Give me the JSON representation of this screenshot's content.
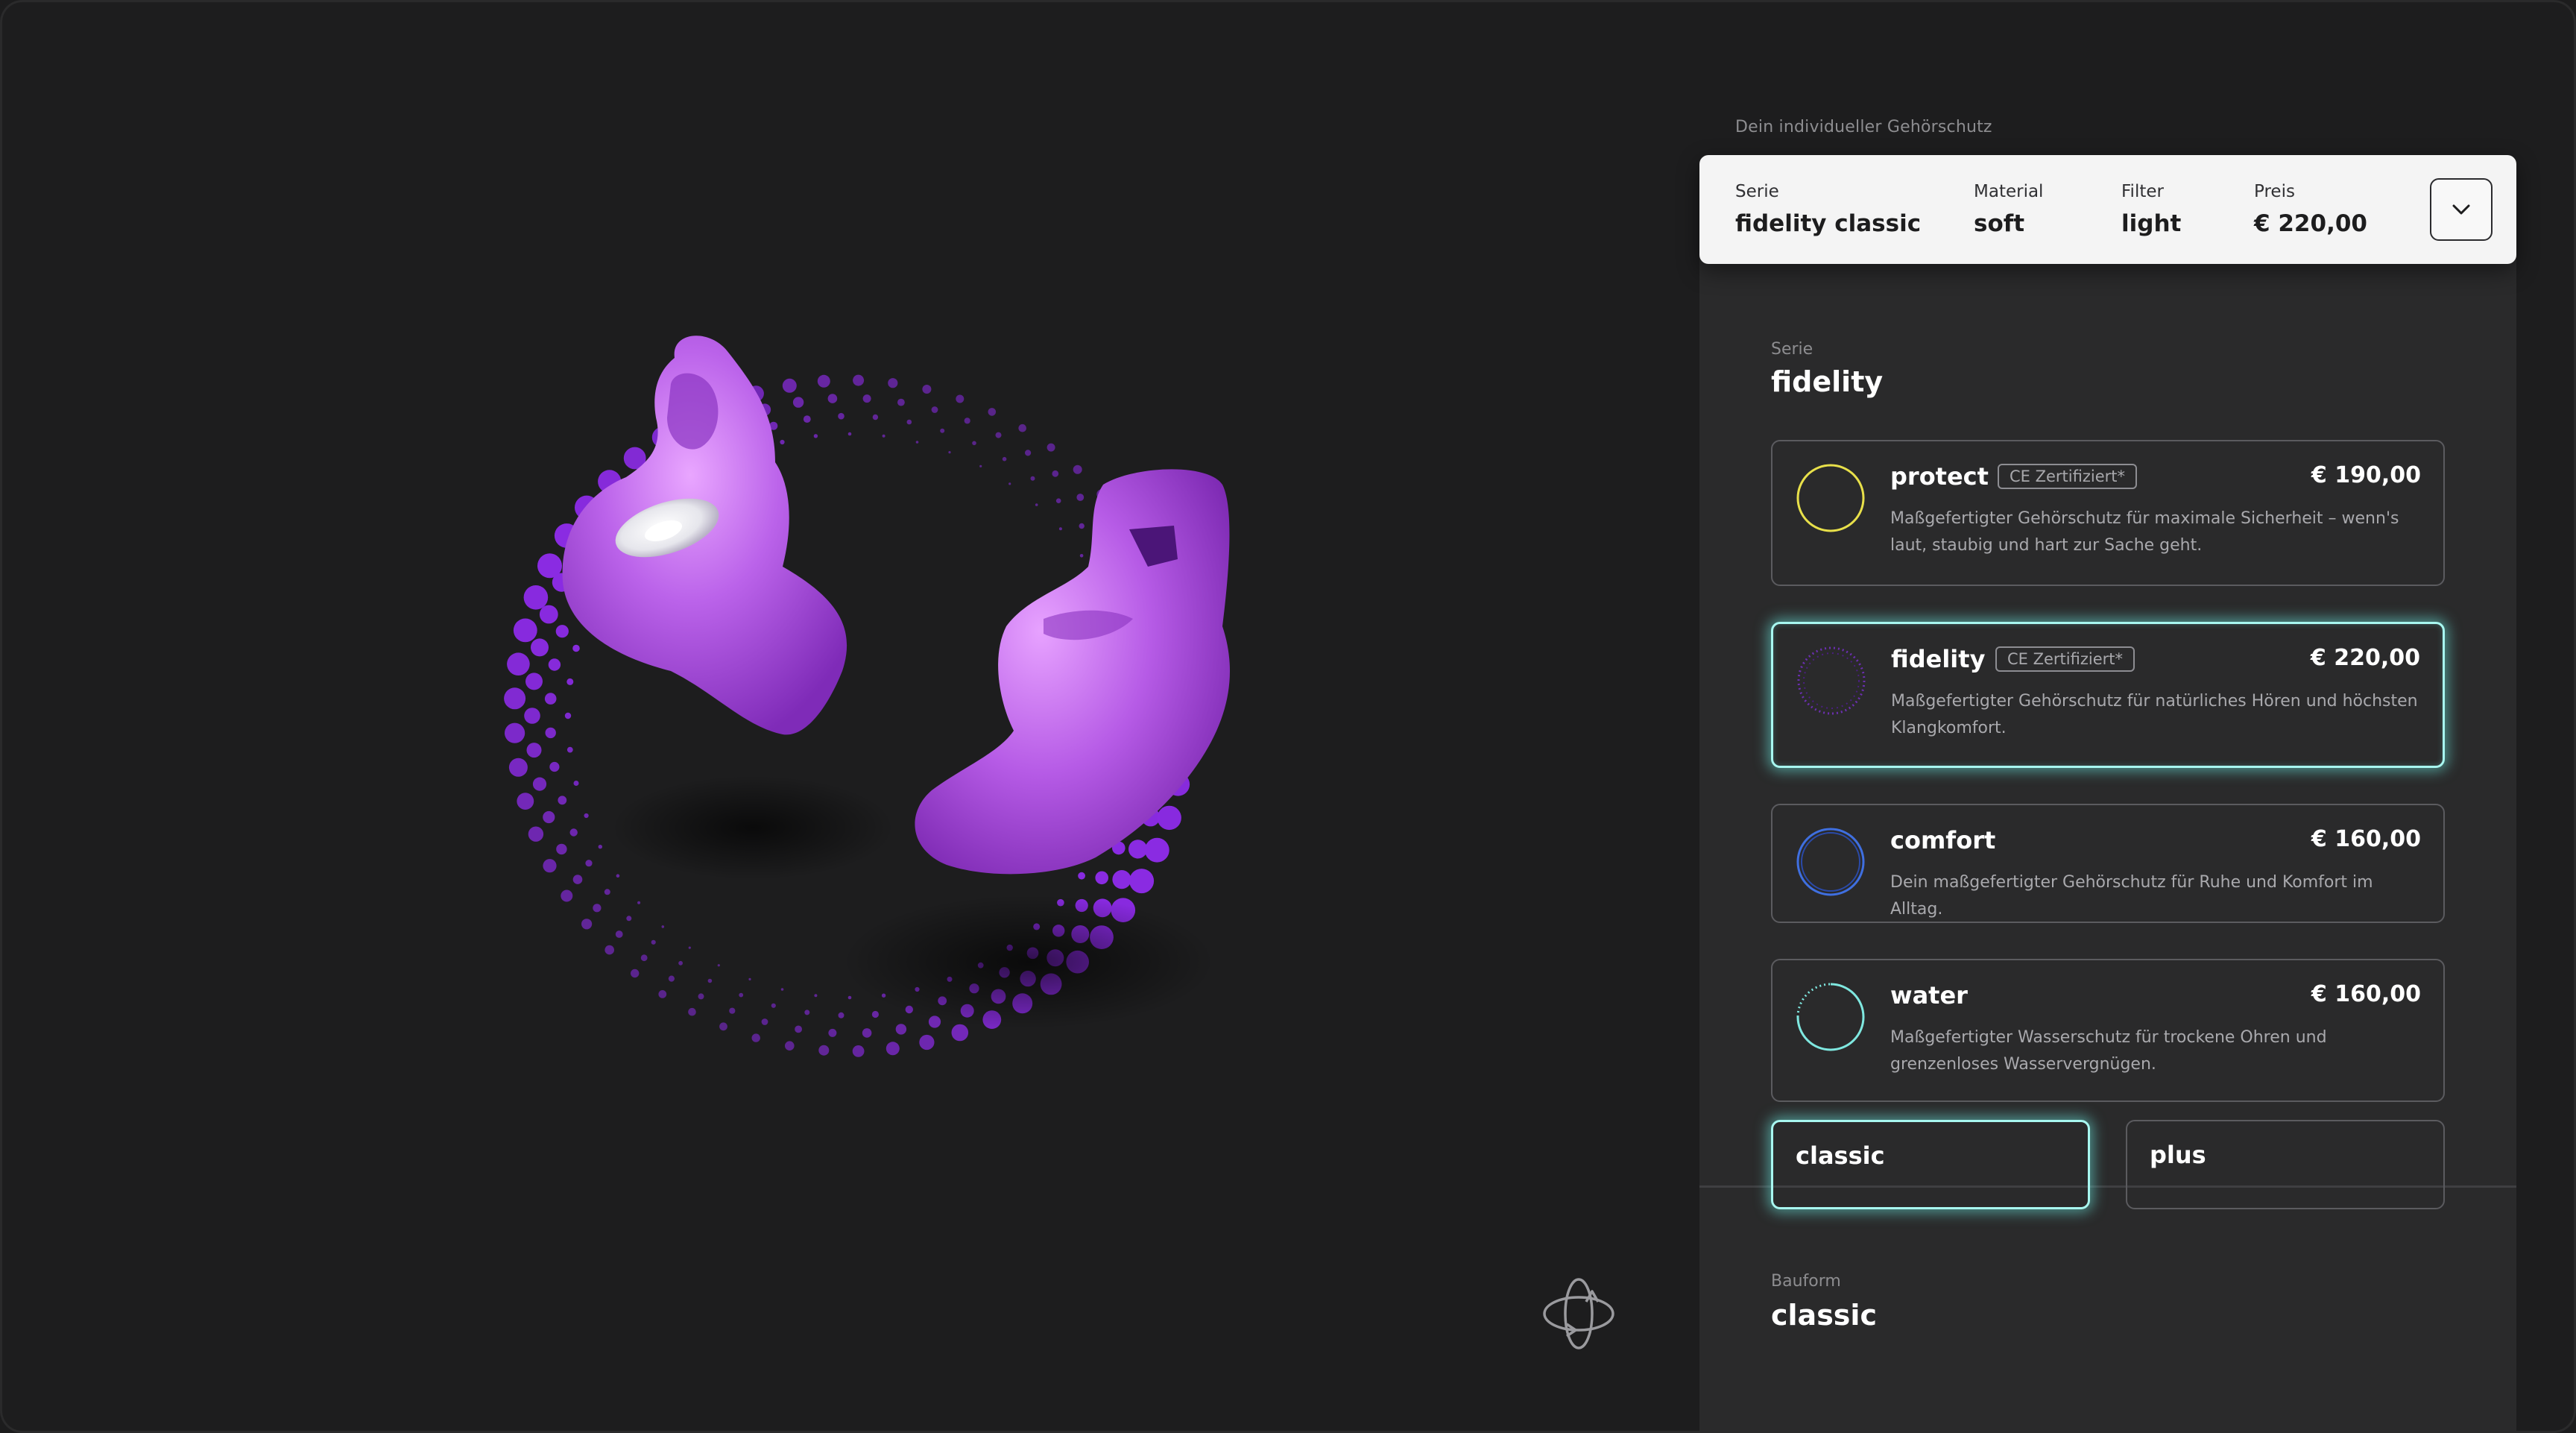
{
  "panel": {
    "caption": "Dein individueller Gehörschutz",
    "summary": {
      "serie_label": "Serie",
      "serie_value": "fidelity classic",
      "material_label": "Material",
      "material_value": "soft",
      "filter_label": "Filter",
      "filter_value": "light",
      "preis_label": "Preis",
      "preis_value": "€ 220,00",
      "expand_icon": "chevron-down-icon"
    },
    "serie_section": {
      "label": "Serie",
      "value": "fidelity",
      "options": [
        {
          "name": "protect",
          "badge": "CE Zertifiziert*",
          "price": "€ 190,00",
          "description": "Maßgefertigter Gehörschutz für maximale Sicherheit – wenn's laut, staubig und hart zur Sache geht.",
          "icon_color": "#e8e04a",
          "selected": false
        },
        {
          "name": "fidelity",
          "badge": "CE Zertifiziert*",
          "price": "€ 220,00",
          "description": "Maßgefertigter Gehörschutz für natürliches Hören und höchsten Klangkomfort.",
          "icon_color": "#6b2fb0",
          "selected": true
        },
        {
          "name": "comfort",
          "badge": "",
          "price": "€ 160,00",
          "description": "Dein maßgefertigter Gehörschutz für Ruhe und Komfort im Alltag.",
          "icon_color": "#3f6fe0",
          "selected": false
        },
        {
          "name": "water",
          "badge": "",
          "price": "€ 160,00",
          "description": "Maßgefertigter Wasserschutz für trockene Ohren und grenzenloses Wasservergnügen.",
          "icon_color": "#7fe8e0",
          "selected": false
        }
      ]
    },
    "bauform_section": {
      "label": "Bauform",
      "value": "classic",
      "options": [
        {
          "name": "classic",
          "selected": true
        },
        {
          "name": "plus",
          "selected": false
        }
      ]
    }
  },
  "viewer": {
    "rotate_icon": "rotate-360-icon",
    "product_color": "#b45ee6",
    "dot_color": "#8a2be2"
  }
}
